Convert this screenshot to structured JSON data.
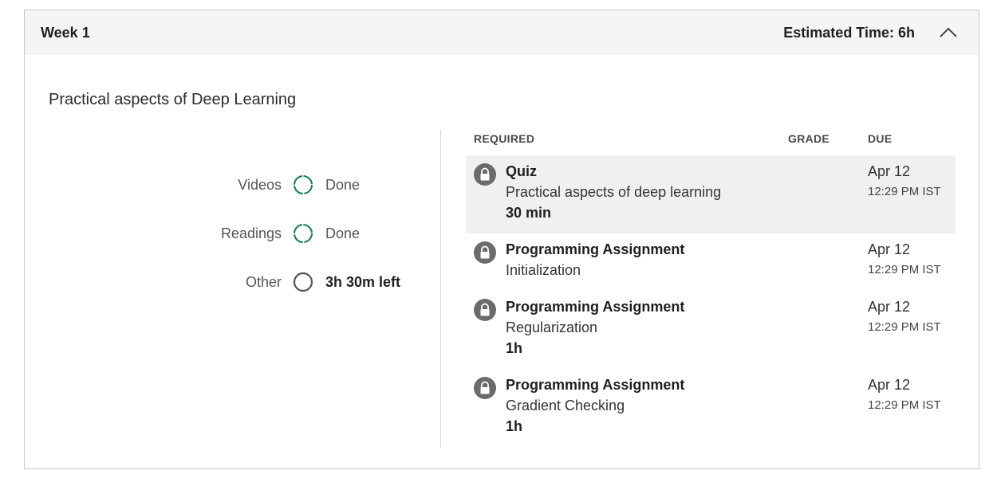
{
  "header": {
    "week_title": "Week 1",
    "estimated_time": "Estimated Time: 6h"
  },
  "section_title": "Practical aspects of Deep Learning",
  "summary": [
    {
      "label": "Videos",
      "status": "Done",
      "icon": "progress-complete-icon",
      "complete": true
    },
    {
      "label": "Readings",
      "status": "Done",
      "icon": "progress-complete-icon",
      "complete": true
    },
    {
      "label": "Other",
      "status": "3h 30m left",
      "icon": "progress-empty-icon",
      "complete": false
    }
  ],
  "table": {
    "headers": {
      "required": "REQUIRED",
      "grade": "GRADE",
      "due": "DUE"
    },
    "items": [
      {
        "type": "Quiz",
        "name": "Practical aspects of deep learning",
        "duration": "30 min",
        "due_date": "Apr 12",
        "due_time": "12:29 PM IST",
        "icon": "lock-icon"
      },
      {
        "type": "Programming Assignment",
        "name": "Initialization",
        "duration": "",
        "due_date": "Apr 12",
        "due_time": "12:29 PM IST",
        "icon": "lock-icon"
      },
      {
        "type": "Programming Assignment",
        "name": "Regularization",
        "duration": "1h",
        "due_date": "Apr 12",
        "due_time": "12:29 PM IST",
        "icon": "lock-icon"
      },
      {
        "type": "Programming Assignment",
        "name": "Gradient Checking",
        "duration": "1h",
        "due_date": "Apr 12",
        "due_time": "12:29 PM IST",
        "icon": "lock-icon"
      }
    ]
  },
  "colors": {
    "complete_green": "#1f8354",
    "empty_ring": "#555555",
    "lock_bg": "#6b6b6b",
    "highlight_row": "#f0f0f0",
    "header_bg": "#f5f5f5"
  }
}
